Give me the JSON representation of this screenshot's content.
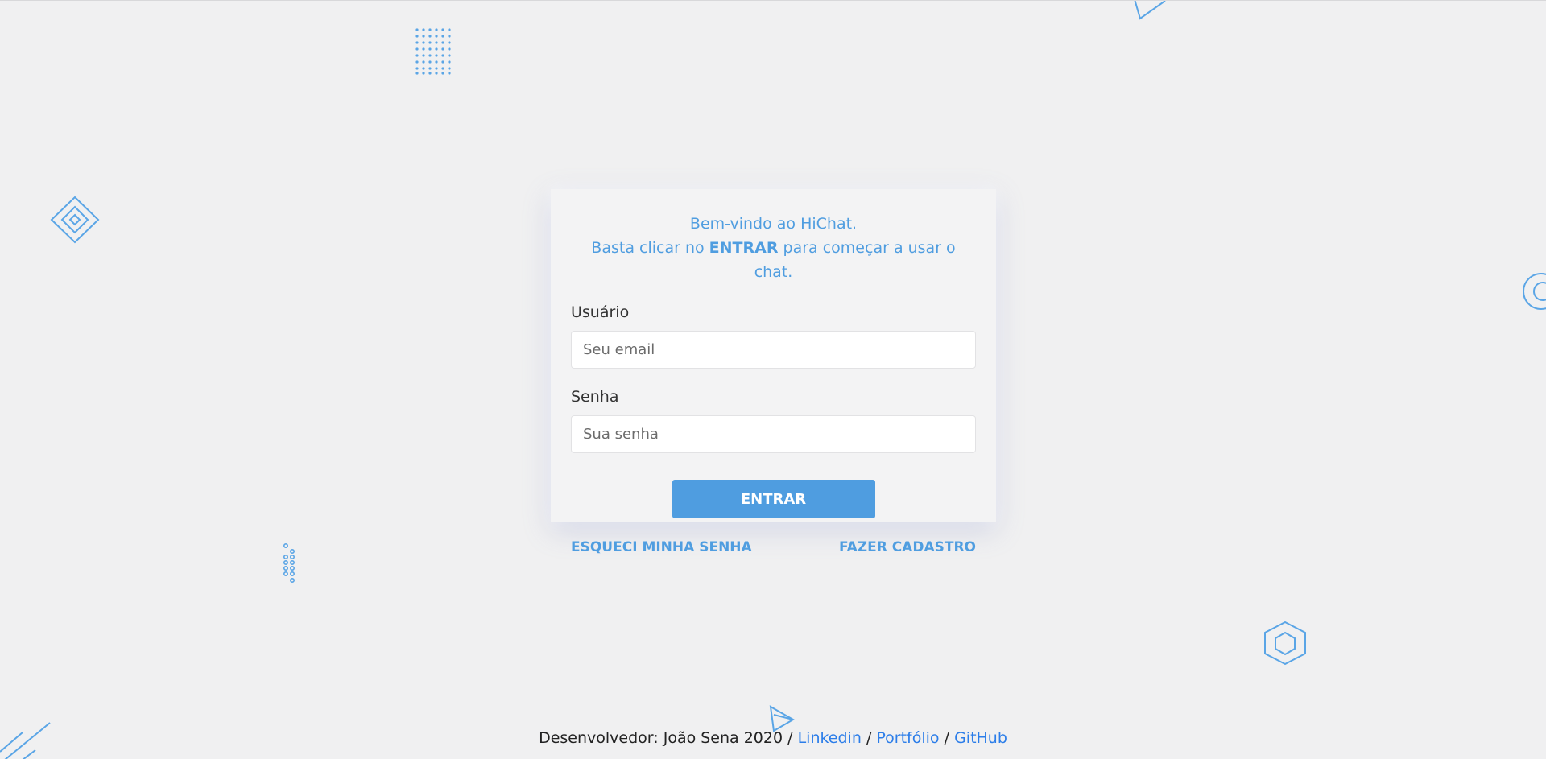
{
  "login": {
    "welcome_line1": "Bem-vindo ao HiChat.",
    "welcome_line2_prefix": "Basta clicar no",
    "welcome_line2_strong": "ENTRAR",
    "welcome_line2_suffix": "para começar a usar o chat.",
    "user_label": "Usuário",
    "user_placeholder": "Seu email",
    "user_value": "",
    "password_label": "Senha",
    "password_placeholder": "Sua senha",
    "password_value": "",
    "submit_label": "ENTRAR"
  },
  "links": {
    "forgot_password": "ESQUECI MINHA SENHA",
    "register": "FAZER CADASTRO"
  },
  "footer": {
    "developer_text": "Desenvolvedor: João Sena 2020",
    "separator": "/",
    "linkedin": "Linkedin",
    "portfolio": "Portfólio",
    "github": "GitHub"
  },
  "colors": {
    "accent": "#4f9de0",
    "background": "#f0f0f1",
    "card": "#f3f3f4",
    "footer_link": "#2b7de9"
  },
  "decorations": [
    "dot-grid-icon",
    "triangle-icon",
    "diamond-icon",
    "circle-icon",
    "dot-column-icon",
    "hexagon-icon",
    "paper-plane-icon",
    "diagonal-lines-icon"
  ]
}
